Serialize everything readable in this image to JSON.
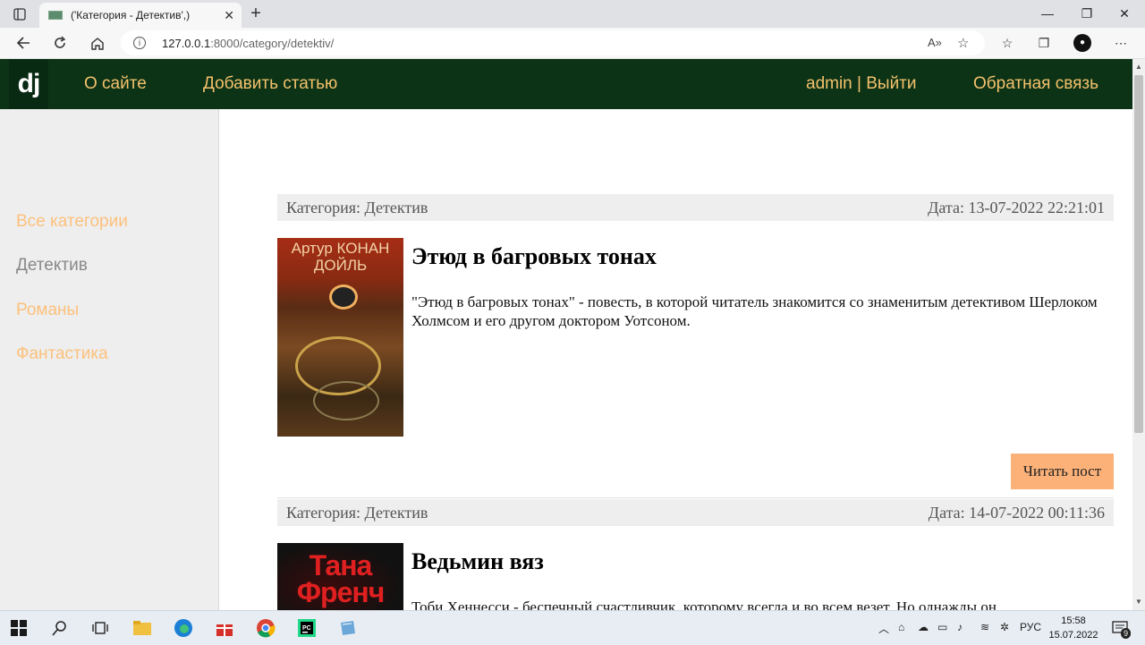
{
  "browser": {
    "tab_title": "('Категория - Детектив',)",
    "url_host": "127.0.0.1",
    "url_path": ":8000/category/detektiv/",
    "window_controls": [
      "—",
      "❐",
      "✕"
    ]
  },
  "site": {
    "logo": "dj",
    "nav": {
      "about": "О сайте",
      "add_article": "Добавить статью",
      "user": "admin | Выйти",
      "feedback": "Обратная связь"
    },
    "sidebar": {
      "all_categories": "Все категории",
      "categories": [
        "Детектив",
        "Романы",
        "Фантастика"
      ],
      "active_category": "Детектив"
    },
    "posts": [
      {
        "category": "Категория: Детектив",
        "date": "Дата: 13-07-2022 22:21:01",
        "title": "Этюд в багровых тонах",
        "excerpt": "\"Этюд в багровых тонах\" - повесть, в которой читатель знакомится со знаменитым детективом Шерлоком Холмсом и его другом доктором Уотсоном.",
        "cover_author": "Артур КОНАН ДОЙЛЬ",
        "read_label": "Читать пост"
      },
      {
        "category": "Категория: Детектив",
        "date": "Дата: 14-07-2022 00:11:36",
        "title": "Ведьмин вяз",
        "excerpt": "Тоби Хеннесси - беспечный счастливчик, которому всегда и во всем везет. Но однажды он",
        "cover_author": "Тана Френч"
      }
    ]
  },
  "taskbar": {
    "language": "РУС",
    "time": "15:58",
    "date": "15.07.2022",
    "notifications": "9"
  },
  "colors": {
    "header_bg": "#0c3316",
    "nav_link": "#f5c16c",
    "sidebar_link": "#fcc17c",
    "read_button": "#fbb178"
  }
}
